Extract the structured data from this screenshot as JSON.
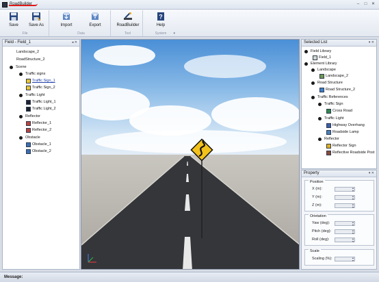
{
  "window": {
    "title": "RoadBuilder",
    "accent": "#e01818"
  },
  "ribbon": {
    "groups": [
      {
        "label": "File",
        "buttons": [
          {
            "label": "Save",
            "icon": "save-icon"
          },
          {
            "label": "Save As",
            "icon": "save-as-icon"
          }
        ]
      },
      {
        "label": "Data",
        "buttons": [
          {
            "label": "Import",
            "icon": "import-icon"
          },
          {
            "label": "Export",
            "icon": "export-icon"
          }
        ]
      },
      {
        "label": "Tool",
        "buttons": [
          {
            "label": "RoadBuilder",
            "icon": "road-builder-icon"
          }
        ]
      },
      {
        "label": "System",
        "buttons": [
          {
            "label": "Help",
            "icon": "help-icon"
          }
        ]
      }
    ]
  },
  "field_panel": {
    "header": "Field - Field_1",
    "tree": [
      {
        "label": "Landscape_2",
        "kind": "text"
      },
      {
        "label": "RoadStructure_2",
        "kind": "text"
      },
      {
        "label": "Scene",
        "kind": "node"
      },
      {
        "label": "Traffic signs",
        "kind": "node"
      },
      {
        "label": "Traffic Sign_1",
        "kind": "leaf",
        "selected": true
      },
      {
        "label": "Traffic Sign_2",
        "kind": "leaf"
      },
      {
        "label": "Traffic Light",
        "kind": "node"
      },
      {
        "label": "Traffic Light_1",
        "kind": "leaf"
      },
      {
        "label": "Traffic Light_2",
        "kind": "leaf"
      },
      {
        "label": "Reflector",
        "kind": "node"
      },
      {
        "label": "Reflector_1",
        "kind": "leaf"
      },
      {
        "label": "Reflector_2",
        "kind": "leaf"
      },
      {
        "label": "Obstacle",
        "kind": "node"
      },
      {
        "label": "Obstacle_1",
        "kind": "leaf"
      },
      {
        "label": "Obstacle_2",
        "kind": "leaf"
      }
    ]
  },
  "selected_panel": {
    "header": "Selected List",
    "tree": [
      {
        "label": "Field Library",
        "kind": "node"
      },
      {
        "label": "Field_1",
        "kind": "leaf"
      },
      {
        "label": "Element Library",
        "kind": "node"
      },
      {
        "label": "Landscape",
        "kind": "node"
      },
      {
        "label": "Landscape_2",
        "kind": "leaf"
      },
      {
        "label": "Road Structure",
        "kind": "node"
      },
      {
        "label": "Road Structure_2",
        "kind": "leaf"
      },
      {
        "label": "Traffic References",
        "kind": "node"
      },
      {
        "label": "Traffic Sign",
        "kind": "node"
      },
      {
        "label": "Cross Road",
        "kind": "leaf"
      },
      {
        "label": "Traffic Light",
        "kind": "node"
      },
      {
        "label": "Highway Overhang",
        "kind": "leaf"
      },
      {
        "label": "Roadside Lamp",
        "kind": "leaf"
      },
      {
        "label": "Reflector",
        "kind": "node"
      },
      {
        "label": "Reflector Sign",
        "kind": "leaf"
      },
      {
        "label": "Reflective Roadside Post",
        "kind": "leaf"
      }
    ]
  },
  "property_panel": {
    "header": "Property",
    "position": {
      "title": "Position",
      "fields": [
        "X (m):",
        "Y (m):",
        "Z (m):"
      ]
    },
    "orientation": {
      "title": "Orietation",
      "fields": [
        "Yaw (deg):",
        "Pitch (deg):",
        "Roll (deg):"
      ]
    },
    "scale": {
      "title": "Scale",
      "fields": [
        "Scaling (%):"
      ]
    }
  },
  "status": {
    "label": "Message:"
  }
}
